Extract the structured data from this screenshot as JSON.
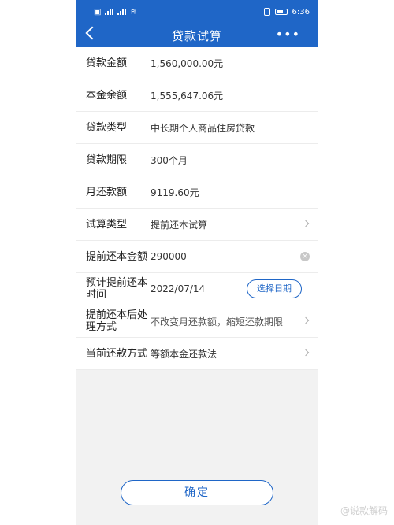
{
  "statusbar": {
    "time": "6:36"
  },
  "navbar": {
    "title": "贷款试算",
    "more": "•••"
  },
  "rows": [
    {
      "label": "贷款金额",
      "value": "1,560,000.00元"
    },
    {
      "label": "本金余额",
      "value": "1,555,647.06元"
    },
    {
      "label": "贷款类型",
      "value": "中长期个人商品住房贷款"
    },
    {
      "label": "贷款期限",
      "value": "300个月"
    },
    {
      "label": "月还款额",
      "value": "9119.60元"
    },
    {
      "label": "试算类型",
      "value": "提前还本试算"
    },
    {
      "label": "提前还本金额",
      "value": "290000"
    },
    {
      "label": "预计提前还本时间",
      "value": "2022/07/14",
      "button": "选择日期"
    },
    {
      "label": "提前还本后处理方式",
      "value": "不改变月还款额，缩短还款期限"
    },
    {
      "label": "当前还款方式",
      "value": "等额本金还款法"
    }
  ],
  "confirm_label": "确定",
  "watermark": "@说款解码"
}
